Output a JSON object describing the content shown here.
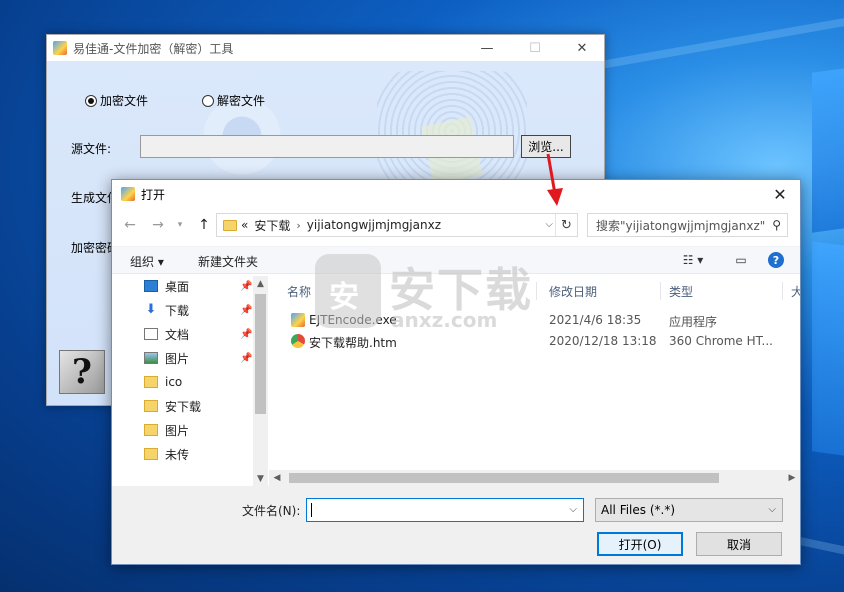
{
  "main_window": {
    "title": "易佳通-文件加密（解密）工具",
    "minimize_icon": "minimize-icon",
    "maximize_icon": "maximize-icon",
    "close_icon": "close-icon",
    "mode_options": [
      {
        "label": "加密文件",
        "selected": true
      },
      {
        "label": "解密文件",
        "selected": false
      }
    ],
    "source_label": "源文件:",
    "source_value": "",
    "browse_label": "浏览...",
    "output_label": "生成文件",
    "password_label": "加密密码",
    "help_glyph": "?"
  },
  "dialog": {
    "title": "打开",
    "address": {
      "overflow": "«",
      "crumbs": [
        "安下载",
        "yijiatongwjjmjmgjanxz"
      ]
    },
    "search_placeholder": "搜索\"yijiatongwjjmjmgjanxz\"",
    "toolbar": {
      "organize_label": "组织 ▾",
      "new_folder_label": "新建文件夹"
    },
    "nav_items": [
      {
        "label": "桌面",
        "icon": "desktop-icon",
        "pinned": true
      },
      {
        "label": "下载",
        "icon": "download-icon",
        "pinned": true
      },
      {
        "label": "文档",
        "icon": "document-icon",
        "pinned": true
      },
      {
        "label": "图片",
        "icon": "pictures-icon",
        "pinned": true
      },
      {
        "label": "ico",
        "icon": "folder-icon",
        "pinned": false
      },
      {
        "label": "安下载",
        "icon": "folder-icon",
        "pinned": false
      },
      {
        "label": "图片",
        "icon": "folder-icon",
        "pinned": false
      },
      {
        "label": "未传",
        "icon": "folder-icon",
        "pinned": false
      }
    ],
    "columns": [
      "名称",
      "修改日期",
      "类型",
      "大"
    ],
    "files": [
      {
        "name": "EJTEncode.exe",
        "date": "2021/4/6 18:35",
        "type": "应用程序",
        "icon": "exe-icon"
      },
      {
        "name": "安下载帮助.htm",
        "date": "2020/12/18 13:18",
        "type": "360 Chrome HT...",
        "icon": "htm-icon"
      }
    ],
    "filename_label": "文件名(N):",
    "filename_value": "",
    "filter_value": "All Files (*.*)",
    "open_label": "打开(O)",
    "cancel_label": "取消"
  },
  "watermark": {
    "big": "安下载",
    "small": "anxz.com"
  },
  "colors": {
    "accent": "#0078d7",
    "arrow": "#e0191f",
    "desktop": "#0d5fc2"
  }
}
